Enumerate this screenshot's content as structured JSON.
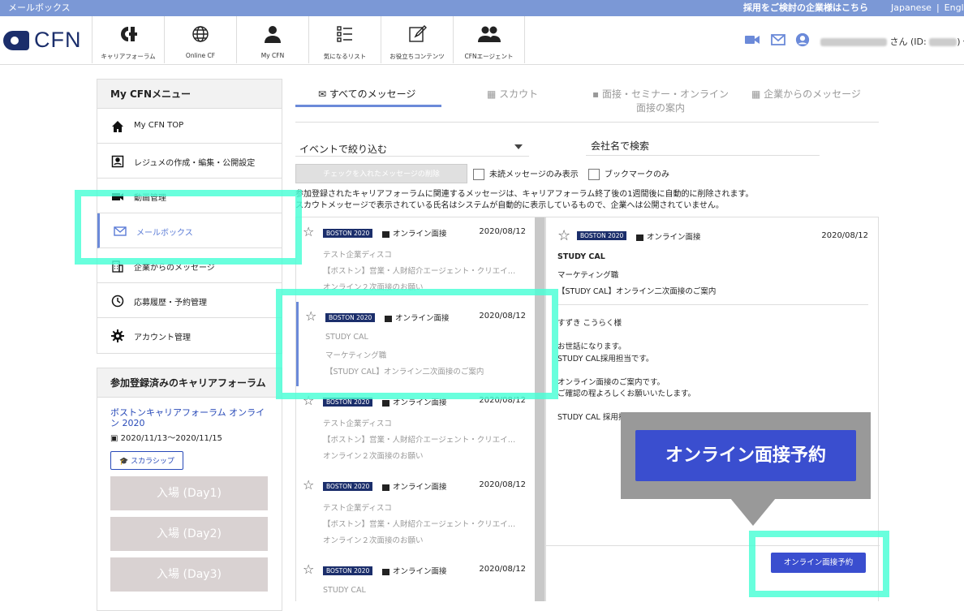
{
  "topbar": {
    "title": "メールボックス",
    "corp_link": "採用をご検討の企業様はこちら",
    "lang_ja": "Japanese",
    "lang_sep": "|",
    "lang_en": "English"
  },
  "logo": {
    "text": "CFN"
  },
  "nav": [
    {
      "label": "キャリアフォーラム",
      "icon": "cf-logo-icon"
    },
    {
      "label": "Online CF",
      "icon": "globe-icon"
    },
    {
      "label": "My CFN",
      "icon": "person-icon"
    },
    {
      "label": "気になるリスト",
      "icon": "list-icon"
    },
    {
      "label": "お役立ちコンテンツ",
      "icon": "edit-icon"
    },
    {
      "label": "CFNエージェント",
      "icon": "group-icon"
    }
  ],
  "user": {
    "suffix": "さん (ID:",
    "close": ")"
  },
  "sidebar": {
    "menu_title": "My CFNメニュー",
    "items": [
      {
        "label": "My CFN TOP",
        "icon": "home-icon"
      },
      {
        "label": "レジュメの作成・編集・公開設定",
        "icon": "resume-icon"
      },
      {
        "label": "動画管理",
        "icon": "video-icon"
      },
      {
        "label": "メールボックス",
        "icon": "mail-icon"
      },
      {
        "label": "企業からのメッセージ",
        "icon": "building-icon"
      },
      {
        "label": "応募履歴・予約管理",
        "icon": "history-icon"
      },
      {
        "label": "アカウント管理",
        "icon": "gear-icon"
      }
    ],
    "forum_title": "参加登録済みのキャリアフォーラム",
    "forum_name": "ボストンキャリアフォーラム オンライン 2020",
    "forum_dates": "2020/11/13〜2020/11/15",
    "scholarship": "スカラシップ",
    "entries": [
      "入場 (Day1)",
      "入場 (Day2)",
      "入場 (Day3)"
    ]
  },
  "tabs": [
    {
      "label": "すべてのメッセージ"
    },
    {
      "label": "スカウト"
    },
    {
      "label": "面接・セミナー・オンライン"
    },
    {
      "label": "企業からのメッセージ"
    }
  ],
  "tab_sub": "面接の案内",
  "filter": {
    "event": "イベントで絞り込む",
    "search_placeholder": "会社名で検索",
    "delete": "チェックを入れたメッセージの削除",
    "unread": "未読メッセージのみ表示",
    "bookmark": "ブックマークのみ"
  },
  "notice": [
    "参加登録されたキャリアフォーラムに関連するメッセージは、キャリアフォーラム終了後の1週間後に自動的に削除されます。",
    "スカウトメッセージで表示されている氏名はシステムが自動的に表示しているもので、企業へは公開されていません。"
  ],
  "messages": [
    {
      "tag": "BOSTON 2020",
      "type": "オンライン面接",
      "date": "2020/08/12",
      "l1": "テスト企業ディスコ",
      "l2": "【ボストン】営業・人財紹介エージェント・クリエイ…",
      "l3": "オンライン２次面接のお願い"
    },
    {
      "tag": "BOSTON 2020",
      "type": "オンライン面接",
      "date": "2020/08/12",
      "l1": "STUDY CAL",
      "l2": "マーケティング職",
      "l3": "【STUDY CAL】オンライン二次面接のご案内"
    },
    {
      "tag": "BOSTON 2020",
      "type": "オンライン面接",
      "date": "2020/08/12",
      "l1": "テスト企業ディスコ",
      "l2": "【ボストン】営業・人財紹介エージェント・クリエイ…",
      "l3": "オンライン２次面接のお願い"
    },
    {
      "tag": "BOSTON 2020",
      "type": "オンライン面接",
      "date": "2020/08/12",
      "l1": "テスト企業ディスコ",
      "l2": "【ボストン】営業・人財紹介エージェント・クリエイ…",
      "l3": "オンライン２次面接のお願い"
    },
    {
      "tag": "BOSTON 2020",
      "type": "オンライン面接",
      "date": "2020/08/12",
      "l1": "STUDY CAL",
      "l2": "",
      "l3": ""
    }
  ],
  "detail": {
    "tag": "BOSTON 2020",
    "type": "オンライン面接",
    "date": "2020/08/12",
    "company": "STUDY CAL",
    "job": "マーケティング職",
    "subject": "【STUDY CAL】オンライン二次面接のご案内",
    "body": "すずき こうらく様\n\nお世話になります。\nSTUDY CAL採用担当です。\n\nオンライン面接のご案内です。\nご確認の程よろしくお願いいたします。\n\nSTUDY CAL 採用担当"
  },
  "reserve_button": "オンライン面接予約",
  "callout_label": "オンライン面接予約",
  "colors": {
    "accent": "#6b8ad9",
    "brand": "#1b2e6b",
    "button": "#3a4ecf",
    "highlight": "#48ffd6"
  }
}
